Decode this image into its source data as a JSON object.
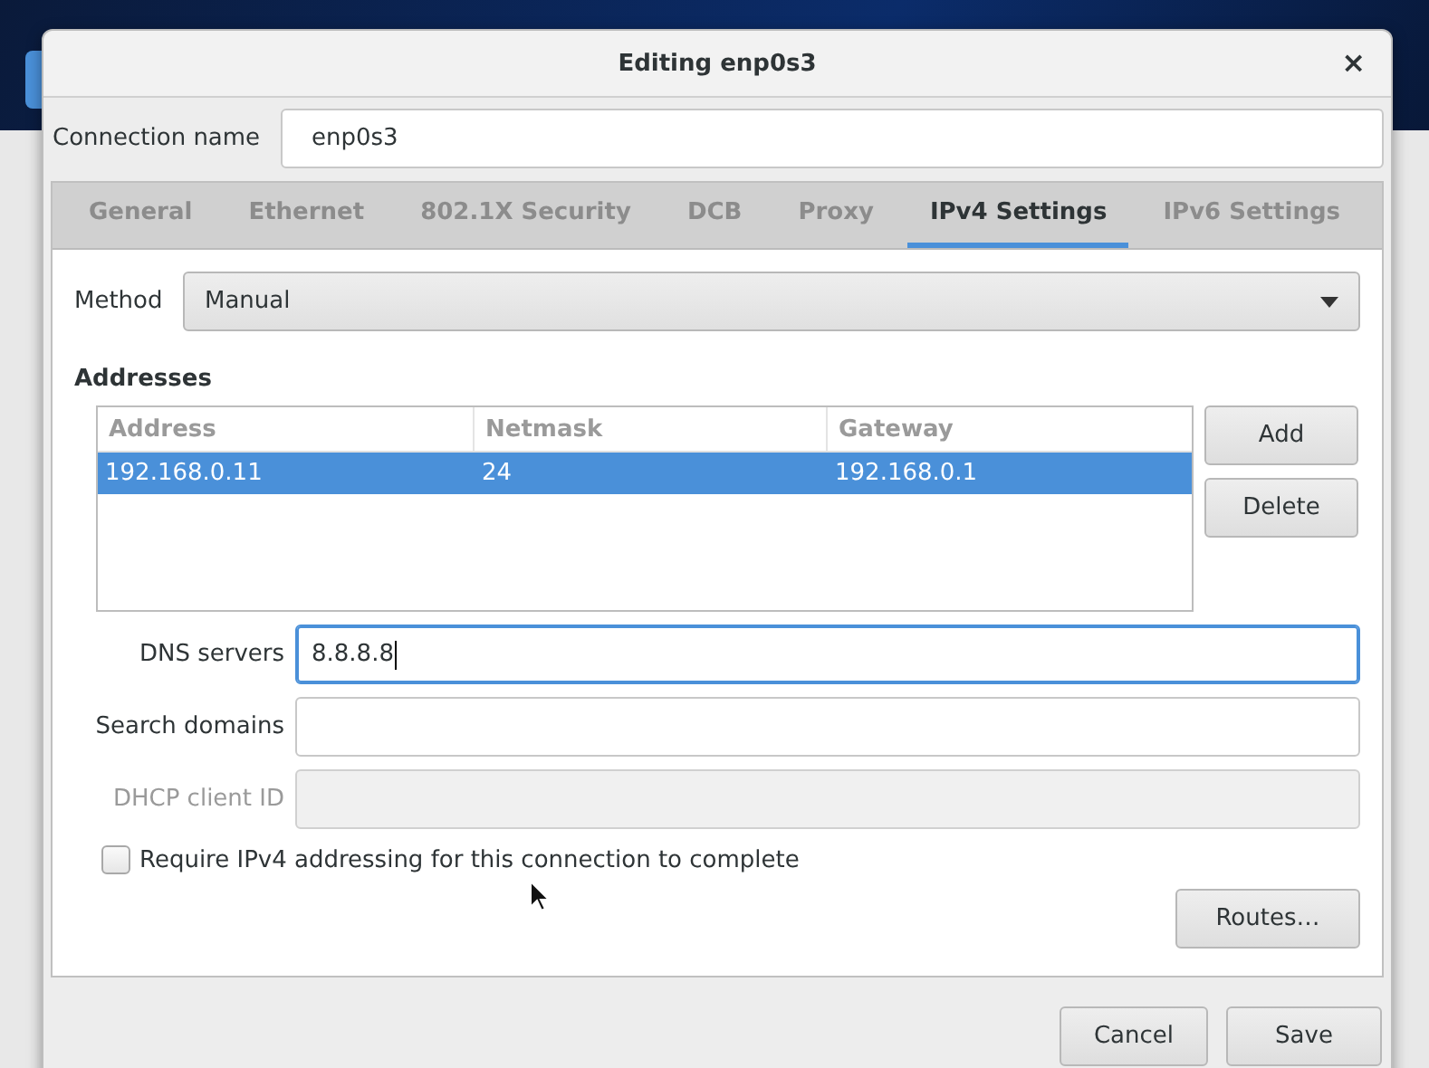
{
  "dialog": {
    "title": "Editing enp0s3",
    "close": "×"
  },
  "connection_name": {
    "label": "Connection name",
    "value": "enp0s3"
  },
  "tabs": [
    {
      "label": "General",
      "selected": false
    },
    {
      "label": "Ethernet",
      "selected": false
    },
    {
      "label": "802.1X Security",
      "selected": false
    },
    {
      "label": "DCB",
      "selected": false
    },
    {
      "label": "Proxy",
      "selected": false
    },
    {
      "label": "IPv4 Settings",
      "selected": true
    },
    {
      "label": "IPv6 Settings",
      "selected": false
    }
  ],
  "method": {
    "label": "Method",
    "value": "Manual"
  },
  "addresses": {
    "label": "Addresses",
    "columns": [
      "Address",
      "Netmask",
      "Gateway"
    ],
    "rows": [
      {
        "cells": [
          "192.168.0.11",
          "24",
          "192.168.0.1"
        ],
        "selected": true
      }
    ],
    "buttons": [
      "Add",
      "Delete"
    ]
  },
  "fields": [
    {
      "label": "DNS servers",
      "value": "8.8.8.8",
      "focused": true,
      "disabled": false
    },
    {
      "label": "Search domains",
      "focused": false,
      "disabled": false
    },
    {
      "label": "DHCP client ID",
      "focused": false,
      "disabled": true
    }
  ],
  "require": {
    "label": "Require IPv4 addressing for this connection to complete",
    "checked": false
  },
  "routes_button": "Routes…",
  "buttons": [
    "Cancel",
    "Save"
  ]
}
